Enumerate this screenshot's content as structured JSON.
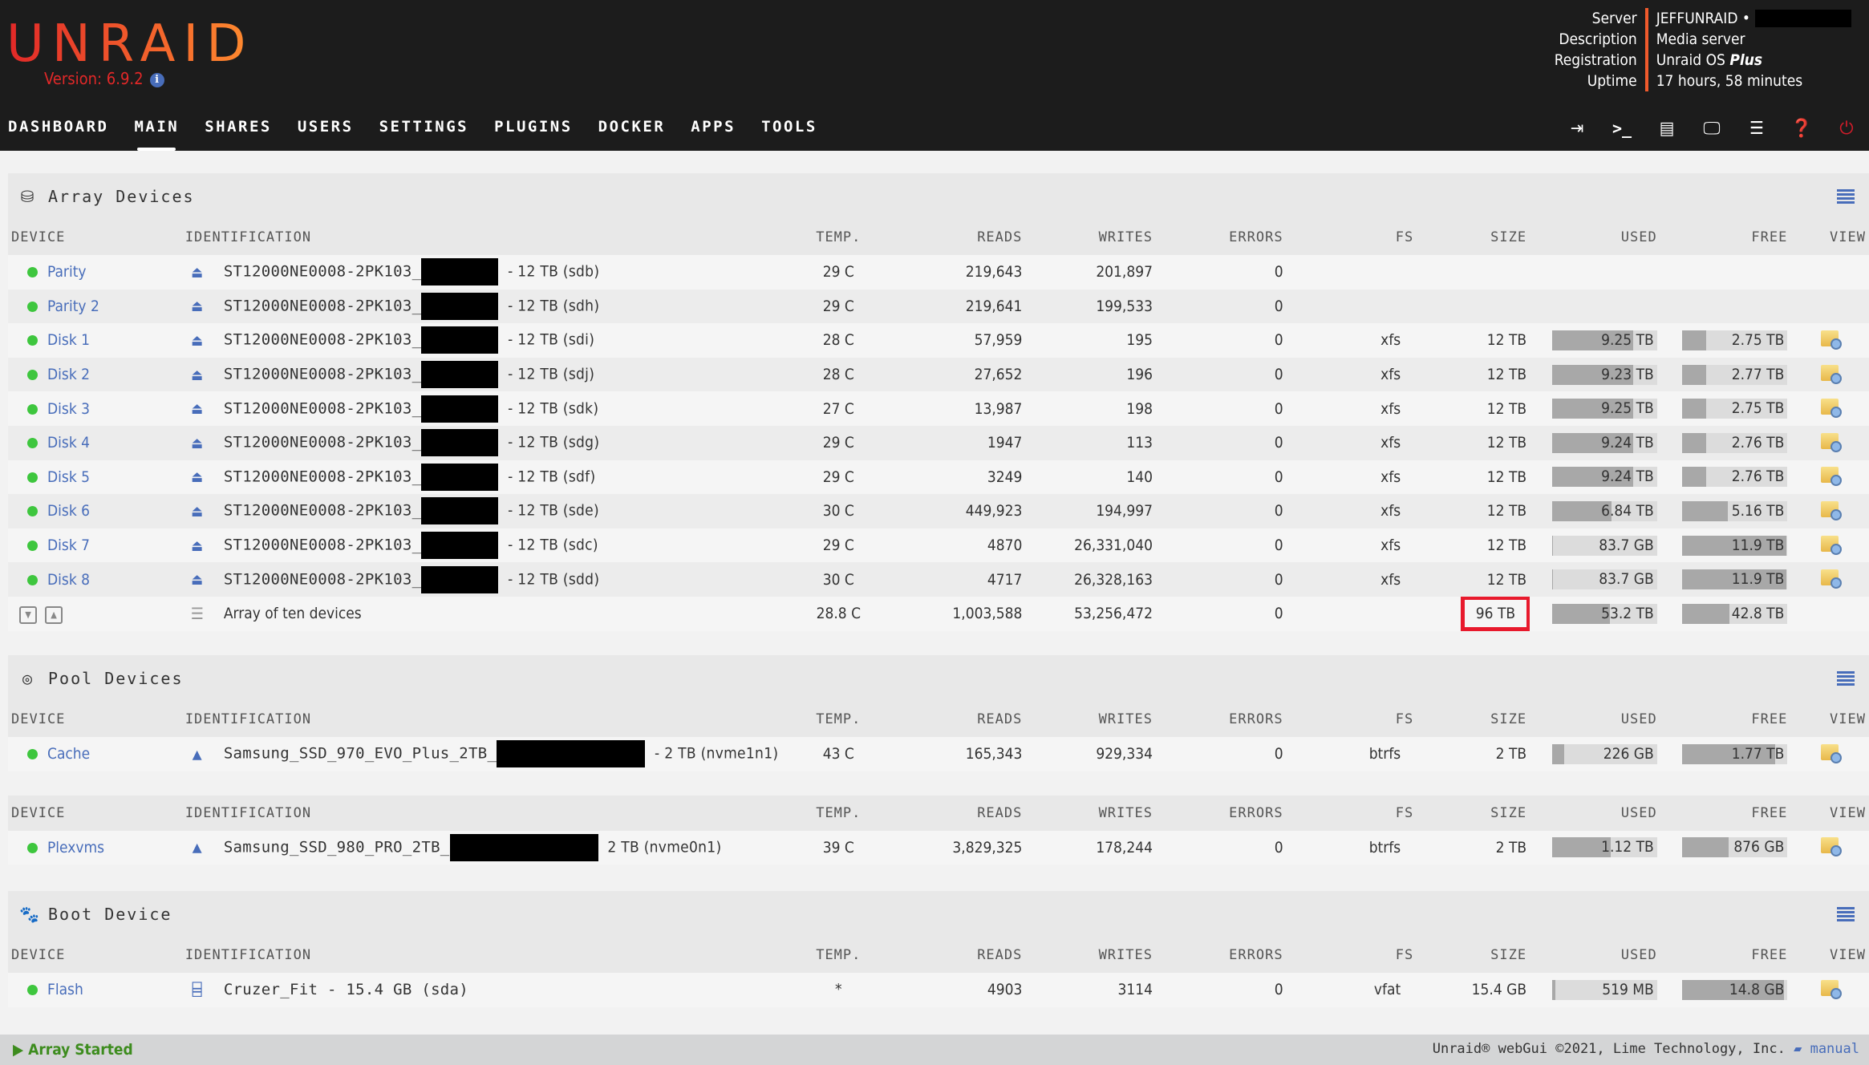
{
  "header": {
    "logo": "UNRAID",
    "version": "Version: 6.9.2",
    "server_info": [
      {
        "key": "Server",
        "value": "JEFFUNRAID •",
        "redacted": true
      },
      {
        "key": "Description",
        "value": "Media server"
      },
      {
        "key": "Registration",
        "value": "Unraid OS ",
        "value_em": "Plus"
      },
      {
        "key": "Uptime",
        "value": "17 hours, 58 minutes"
      }
    ]
  },
  "nav": {
    "items": [
      "DASHBOARD",
      "MAIN",
      "SHARES",
      "USERS",
      "SETTINGS",
      "PLUGINS",
      "DOCKER",
      "APPS",
      "TOOLS"
    ],
    "active": "MAIN",
    "icons": [
      "logout-icon",
      "terminal-icon",
      "feedback-icon",
      "vm-display-icon",
      "log-icon",
      "help-icon",
      "power-icon"
    ]
  },
  "columns": [
    "DEVICE",
    "IDENTIFICATION",
    "TEMP.",
    "READS",
    "WRITES",
    "ERRORS",
    "FS",
    "SIZE",
    "USED",
    "FREE",
    "VIEW"
  ],
  "array": {
    "title": "Array Devices",
    "rows": [
      {
        "device": "Parity",
        "id": "ST12000NE0008-2PK103_",
        "id_suffix": "- 12 TB (sdb)",
        "temp": "29 C",
        "reads": "219,643",
        "writes": "201,897",
        "errors": "0",
        "fs": "",
        "size": "",
        "used": "",
        "free": "",
        "used_pct": null
      },
      {
        "device": "Parity 2",
        "id": "ST12000NE0008-2PK103_",
        "id_suffix": "- 12 TB (sdh)",
        "temp": "29 C",
        "reads": "219,641",
        "writes": "199,533",
        "errors": "0",
        "fs": "",
        "size": "",
        "used": "",
        "free": "",
        "used_pct": null
      },
      {
        "device": "Disk 1",
        "id": "ST12000NE0008-2PK103_",
        "id_suffix": "- 12 TB (sdi)",
        "temp": "28 C",
        "reads": "57,959",
        "writes": "195",
        "errors": "0",
        "fs": "xfs",
        "size": "12 TB",
        "used": "9.25 TB",
        "free": "2.75 TB",
        "used_pct": 77
      },
      {
        "device": "Disk 2",
        "id": "ST12000NE0008-2PK103_",
        "id_suffix": "- 12 TB (sdj)",
        "temp": "28 C",
        "reads": "27,652",
        "writes": "196",
        "errors": "0",
        "fs": "xfs",
        "size": "12 TB",
        "used": "9.23 TB",
        "free": "2.77 TB",
        "used_pct": 77
      },
      {
        "device": "Disk 3",
        "id": "ST12000NE0008-2PK103_",
        "id_suffix": "- 12 TB (sdk)",
        "temp": "27 C",
        "reads": "13,987",
        "writes": "198",
        "errors": "0",
        "fs": "xfs",
        "size": "12 TB",
        "used": "9.25 TB",
        "free": "2.75 TB",
        "used_pct": 77
      },
      {
        "device": "Disk 4",
        "id": "ST12000NE0008-2PK103_",
        "id_suffix": "- 12 TB (sdg)",
        "temp": "29 C",
        "reads": "1947",
        "writes": "113",
        "errors": "0",
        "fs": "xfs",
        "size": "12 TB",
        "used": "9.24 TB",
        "free": "2.76 TB",
        "used_pct": 77
      },
      {
        "device": "Disk 5",
        "id": "ST12000NE0008-2PK103_",
        "id_suffix": "- 12 TB (sdf)",
        "temp": "29 C",
        "reads": "3249",
        "writes": "140",
        "errors": "0",
        "fs": "xfs",
        "size": "12 TB",
        "used": "9.24 TB",
        "free": "2.76 TB",
        "used_pct": 77
      },
      {
        "device": "Disk 6",
        "id": "ST12000NE0008-2PK103_",
        "id_suffix": "- 12 TB (sde)",
        "temp": "30 C",
        "reads": "449,923",
        "writes": "194,997",
        "errors": "0",
        "fs": "xfs",
        "size": "12 TB",
        "used": "6.84 TB",
        "free": "5.16 TB",
        "used_pct": 57
      },
      {
        "device": "Disk 7",
        "id": "ST12000NE0008-2PK103_",
        "id_suffix": "- 12 TB (sdc)",
        "temp": "29 C",
        "reads": "4870",
        "writes": "26,331,040",
        "errors": "0",
        "fs": "xfs",
        "size": "12 TB",
        "used": "83.7 GB",
        "free": "11.9 TB",
        "used_pct": 1
      },
      {
        "device": "Disk 8",
        "id": "ST12000NE0008-2PK103_",
        "id_suffix": "- 12 TB (sdd)",
        "temp": "30 C",
        "reads": "4717",
        "writes": "26,328,163",
        "errors": "0",
        "fs": "xfs",
        "size": "12 TB",
        "used": "83.7 GB",
        "free": "11.9 TB",
        "used_pct": 1
      }
    ],
    "total": {
      "label": "Array of ten devices",
      "temp": "28.8 C",
      "reads": "1,003,588",
      "writes": "53,256,472",
      "errors": "0",
      "size": "96 TB",
      "used": "53.2 TB",
      "free": "42.8 TB",
      "used_pct": 55
    }
  },
  "pool": {
    "title": "Pool Devices",
    "groups": [
      {
        "rows": [
          {
            "device": "Cache",
            "id": "Samsung_SSD_970_EVO_Plus_2TB_",
            "id_suffix": "- 2 TB (nvme1n1)",
            "temp": "43 C",
            "reads": "165,343",
            "writes": "929,334",
            "errors": "0",
            "fs": "btrfs",
            "size": "2 TB",
            "used": "226 GB",
            "free": "1.77 TB",
            "used_pct": 12
          }
        ]
      },
      {
        "rows": [
          {
            "device": "Plexvms",
            "id": "Samsung_SSD_980_PRO_2TB_",
            "id_suffix": "2 TB (nvme0n1)",
            "temp": "39 C",
            "reads": "3,829,325",
            "writes": "178,244",
            "errors": "0",
            "fs": "btrfs",
            "size": "2 TB",
            "used": "1.12 TB",
            "free": "876 GB",
            "used_pct": 56
          }
        ]
      }
    ]
  },
  "boot": {
    "title": "Boot Device",
    "rows": [
      {
        "device": "Flash",
        "id": "Cruzer_Fit - 15.4 GB (sda)",
        "id_suffix": "",
        "temp": "*",
        "reads": "4903",
        "writes": "3114",
        "errors": "0",
        "fs": "vfat",
        "size": "15.4 GB",
        "used": "519 MB",
        "free": "14.8 GB",
        "used_pct": 3
      }
    ]
  },
  "footer": {
    "status": "Array Started",
    "copyright": "Unraid® webGui ©2021, Lime Technology, Inc.",
    "manual": "manual"
  }
}
